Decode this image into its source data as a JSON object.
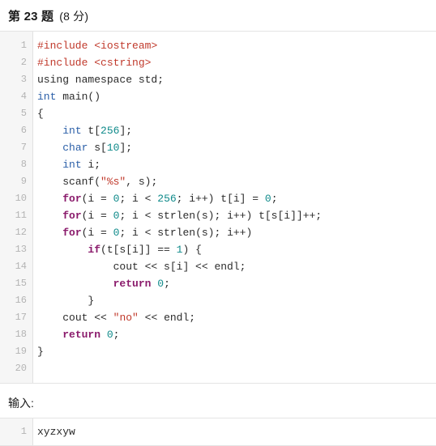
{
  "header": {
    "question_label": "第 23 题",
    "score_label": "(8 分)"
  },
  "code_block": {
    "language": "cpp",
    "line_numbers": [
      "1",
      "2",
      "3",
      "4",
      "5",
      "6",
      "7",
      "8",
      "9",
      "10",
      "11",
      "12",
      "13",
      "14",
      "15",
      "16",
      "17",
      "18",
      "19",
      "20"
    ],
    "lines": [
      "#include <iostream>",
      "#include <cstring>",
      "using namespace std;",
      "int main()",
      "{",
      "    int t[256];",
      "    char s[10];",
      "    int i;",
      "    scanf(\"%s\", s);",
      "    for(i = 0; i < 256; i++) t[i] = 0;",
      "    for(i = 0; i < strlen(s); i++) t[s[i]]++;",
      "    for(i = 0; i < strlen(s); i++)",
      "        if(t[s[i]] == 1) {",
      "            cout << s[i] << endl;",
      "            return 0;",
      "        }",
      "    cout << \"no\" << endl;",
      "    return 0;",
      "}",
      ""
    ],
    "tokens": {
      "preprocessor_color": "#c0392b",
      "string_color": "#c0392b",
      "type_color": "#2b5fa8",
      "keyword_color": "#8a1a6b",
      "number_color": "#0f8a8a",
      "plain_color": "#2b2b2b",
      "gutter_bg": "#f6f6f6",
      "gutter_text_color": "#b4b4b4",
      "border_color": "#e4e4e4"
    },
    "line_1": {
      "pre": "#include",
      "sp": " ",
      "header": "<iostream>"
    },
    "line_2": {
      "pre": "#include",
      "sp": " ",
      "header": "<cstring>"
    },
    "line_3": {
      "text": "using namespace std;"
    },
    "line_4": {
      "type": "int",
      "rest": " main()"
    },
    "line_5": {
      "text": "{"
    },
    "line_6": {
      "indent": "    ",
      "type": "int",
      "mid": " t[",
      "num": "256",
      "end": "];"
    },
    "line_7": {
      "indent": "    ",
      "type": "char",
      "mid": " s[",
      "num": "10",
      "end": "];"
    },
    "line_8": {
      "indent": "    ",
      "type": "int",
      "rest": " i;"
    },
    "line_9": {
      "indent": "    ",
      "pre": "scanf(",
      "str": "\"%s\"",
      "end": ", s);"
    },
    "line_10": {
      "indent": "    ",
      "kw": "for",
      "a": "(i = ",
      "n1": "0",
      "b": "; i < ",
      "n2": "256",
      "c": "; i++) t[i] = ",
      "n3": "0",
      "d": ";"
    },
    "line_11": {
      "indent": "    ",
      "kw": "for",
      "a": "(i = ",
      "n1": "0",
      "b": "; i < strlen(s); i++) t[s[i]]++;"
    },
    "line_12": {
      "indent": "    ",
      "kw": "for",
      "a": "(i = ",
      "n1": "0",
      "b": "; i < strlen(s); i++)"
    },
    "line_13": {
      "indent": "        ",
      "kw": "if",
      "a": "(t[s[i]] == ",
      "n1": "1",
      "b": ") {"
    },
    "line_14": {
      "indent": "            ",
      "text": "cout << s[i] << endl;"
    },
    "line_15": {
      "indent": "            ",
      "kw": "return",
      "a": " ",
      "n1": "0",
      "b": ";"
    },
    "line_16": {
      "indent": "        ",
      "text": "}"
    },
    "line_17": {
      "indent": "    ",
      "a": "cout << ",
      "str": "\"no\"",
      "b": " << endl;"
    },
    "line_18": {
      "indent": "    ",
      "kw": "return",
      "a": " ",
      "n1": "0",
      "b": ";"
    },
    "line_19": {
      "text": "}"
    },
    "line_20": {
      "text": ""
    }
  },
  "input_section": {
    "label": "输入:",
    "line_numbers": [
      "1"
    ],
    "lines": [
      "xyzxyw"
    ]
  }
}
